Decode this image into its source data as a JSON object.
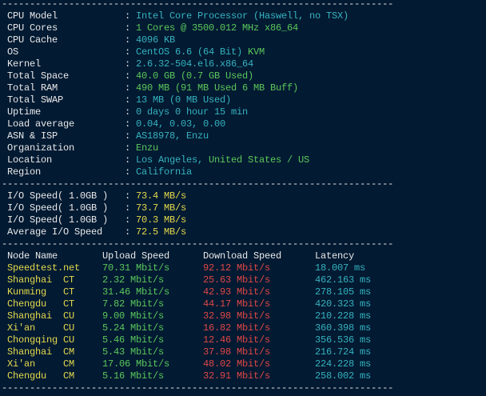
{
  "colors": {
    "background": "#021a32",
    "text": "#e9e9e9",
    "cyan": "#36b3bf",
    "green": "#5bc85b",
    "yellow": "#e3d94c",
    "red": "#e24746"
  },
  "rule": "----------------------------------------------------------------------",
  "separator": ":",
  "system": {
    "cpu_model": {
      "label": "CPU Model",
      "value": "Intel Core Processor (Haswell, no TSX)"
    },
    "cpu_cores": {
      "label": "CPU Cores",
      "value": "1 Cores @ 3500.012 MHz x86_64"
    },
    "cpu_cache": {
      "label": "CPU Cache",
      "value": "4096 KB"
    },
    "os": {
      "label": "OS",
      "value": "CentOS 6.6 (64 Bit)",
      "virtualization": "KVM"
    },
    "kernel": {
      "label": "Kernel",
      "value": "2.6.32-504.el6.x86_64"
    },
    "total_space": {
      "label": "Total Space",
      "value": "40.0 GB (0.7 GB Used)"
    },
    "total_ram": {
      "label": "Total RAM",
      "value": "490 MB (91 MB Used 6 MB Buff)"
    },
    "total_swap": {
      "label": "Total SWAP",
      "value": "13 MB (0 MB Used)"
    },
    "uptime": {
      "label": "Uptime",
      "value": "0 days 0 hour 15 min"
    },
    "load_average": {
      "label": "Load average",
      "value": "0.04, 0.03, 0.00"
    },
    "asn_isp": {
      "label": "ASN & ISP",
      "value": "AS18978, Enzu"
    },
    "organization": {
      "label": "Organization",
      "value": "Enzu"
    },
    "location": {
      "label": "Location",
      "city": "Los Angeles,",
      "country": "United States / US"
    },
    "region": {
      "label": "Region",
      "value": "California"
    }
  },
  "io": {
    "rows": [
      {
        "label": "I/O Speed( 1.0GB )",
        "value": "73.4 MB/s"
      },
      {
        "label": "I/O Speed( 1.0GB )",
        "value": "73.7 MB/s"
      },
      {
        "label": "I/O Speed( 1.0GB )",
        "value": "70.3 MB/s"
      },
      {
        "label": "Average I/O Speed",
        "value": "72.5 MB/s"
      }
    ]
  },
  "speedtest": {
    "columns": [
      "Node Name",
      "Upload Speed",
      "Download Speed",
      "Latency"
    ],
    "rows": [
      {
        "node": "Speedtest.net",
        "upload": "70.31 Mbit/s",
        "download": "92.12 Mbit/s",
        "latency": "18.007 ms"
      },
      {
        "node": "Shanghai",
        "isp": "CT",
        "upload": "2.32 Mbit/s",
        "download": "25.63 Mbit/s",
        "latency": "462.163 ms"
      },
      {
        "node": "Kunming",
        "isp": "CT",
        "upload": "31.46 Mbit/s",
        "download": "42.93 Mbit/s",
        "latency": "278.105 ms"
      },
      {
        "node": "Chengdu",
        "isp": "CT",
        "upload": "7.82 Mbit/s",
        "download": "44.17 Mbit/s",
        "latency": "420.323 ms"
      },
      {
        "node": "Shanghai",
        "isp": "CU",
        "upload": "9.00 Mbit/s",
        "download": "32.98 Mbit/s",
        "latency": "210.228 ms"
      },
      {
        "node": "Xi'an",
        "isp": "CU",
        "upload": "5.24 Mbit/s",
        "download": "16.82 Mbit/s",
        "latency": "360.398 ms"
      },
      {
        "node": "Chongqing",
        "isp": "CU",
        "upload": "5.46 Mbit/s",
        "download": "12.46 Mbit/s",
        "latency": "356.536 ms"
      },
      {
        "node": "Shanghai",
        "isp": "CM",
        "upload": "5.43 Mbit/s",
        "download": "37.98 Mbit/s",
        "latency": "216.724 ms"
      },
      {
        "node": "Xi'an",
        "isp": "CM",
        "upload": "17.06 Mbit/s",
        "download": "48.02 Mbit/s",
        "latency": "224.228 ms"
      },
      {
        "node": "Chengdu",
        "isp": "CM",
        "upload": "5.16 Mbit/s",
        "download": "32.91 Mbit/s",
        "latency": "258.002 ms"
      }
    ]
  }
}
